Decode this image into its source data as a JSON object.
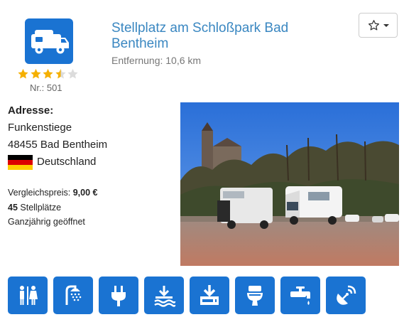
{
  "place": {
    "title": "Stellplatz am Schloßpark Bad Bentheim",
    "distance": "Entfernung: 10,6 km",
    "rating": 3.5,
    "rating_max": 5,
    "number": "Nr.: 501",
    "category_icon": "motorhome-icon"
  },
  "favorite": {
    "icon": "star-outline-icon"
  },
  "address": {
    "heading": "Adresse:",
    "street": "Funkenstiege",
    "city": "48455 Bad Bentheim",
    "country": "Deutschland",
    "flag_colors": [
      "#000000",
      "#dd0000",
      "#ffce00"
    ]
  },
  "details": {
    "price_label": "Vergleichspreis: ",
    "price_value": "9,00 €",
    "spots_count": "45",
    "spots_label": " Stellplätze",
    "season": "Ganzjährig geöffnet"
  },
  "photo": {
    "icon": "campsite-photo"
  },
  "amenities": [
    {
      "icon": "toilet-people-icon"
    },
    {
      "icon": "shower-icon"
    },
    {
      "icon": "power-plug-icon"
    },
    {
      "icon": "water-disposal-icon"
    },
    {
      "icon": "waste-disposal-icon"
    },
    {
      "icon": "wc-icon"
    },
    {
      "icon": "water-tap-icon"
    },
    {
      "icon": "wifi-satellite-icon"
    }
  ],
  "colors": {
    "accent": "#1a73d2",
    "title": "#3a87c1",
    "star": "#f5b000"
  }
}
